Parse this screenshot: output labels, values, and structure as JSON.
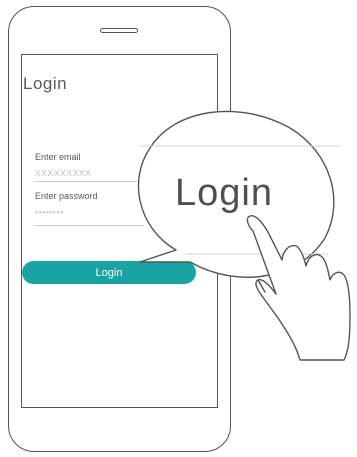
{
  "screen": {
    "title": "Login",
    "email_label": "Enter email",
    "email_placeholder": "XXXXXXXXX",
    "password_label": "Enter password",
    "password_placeholder": "••••••••",
    "login_button": "Login"
  },
  "magnifier": {
    "text": "Login"
  },
  "colors": {
    "accent": "#1aa3a3",
    "outline": "#555555"
  },
  "icons": [
    "hand-pointer-icon",
    "magnifier-callout"
  ]
}
